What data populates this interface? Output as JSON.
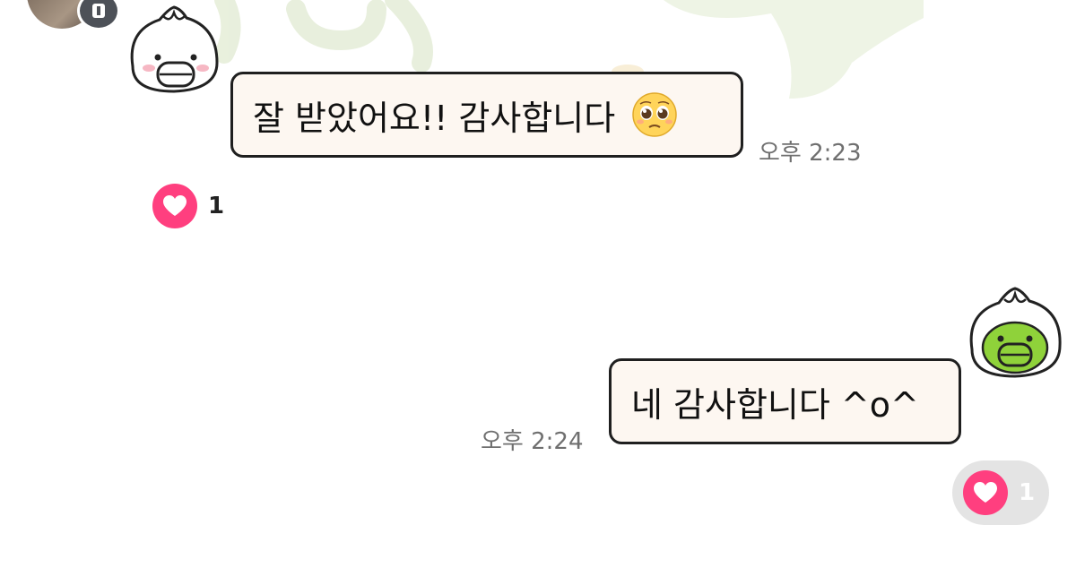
{
  "messages": [
    {
      "text": "잘 받았어요!! 감사합니다",
      "emoji": "pleading-face",
      "time": "오후 2:23",
      "reaction_count": "1",
      "sender": "other"
    },
    {
      "text": "네 감사합니다 ^o^",
      "time": "오후 2:24",
      "reaction_count": "1",
      "sender": "me"
    }
  ],
  "colors": {
    "bubble_fill": "#fdf7f1",
    "bubble_border": "#1f1f1f",
    "heart": "#ff3f7f",
    "time_text": "#6f6f6f",
    "reaction_pill": "#e4e4e4"
  },
  "icons": {
    "reaction": "heart-icon",
    "emoji": "pleading-face-emoji",
    "profile_other": "dumpling-white-face-sticker",
    "profile_me": "dumpling-green-face-sticker"
  }
}
